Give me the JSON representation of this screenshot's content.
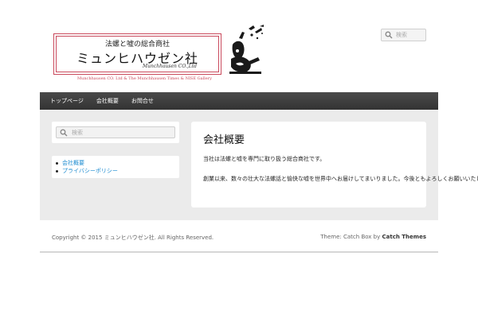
{
  "header": {
    "logo_tagline": "法螺と嘘の総合商社",
    "logo_name": "ミュンヒハウゼン社",
    "logo_script": "Munchhausen CO.,Ltd",
    "logo_subtitle": "Munchhausen CO. Ltd & The Munchhausen Times & NISE Gallery",
    "search_placeholder": "検索"
  },
  "nav": {
    "items": [
      "トップページ",
      "会社概要",
      "お問合せ"
    ]
  },
  "sidebar": {
    "search_placeholder": "検索",
    "links": [
      "会社概要",
      "プライバシーポリシー"
    ]
  },
  "content": {
    "title": "会社概要",
    "paragraph1": "当社は法螺と嘘を専門に取り扱う総合商社です。",
    "paragraph2": "創業以来、数々の壮大な法螺話と愉快な嘘を世界中へお届けしてまいりました。今後ともよろしくお願いいたします。"
  },
  "footer": {
    "copyright": "Copyright © 2015 ミュンヒハウゼン社. All Rights Reserved.",
    "theme_prefix": "Theme: Catch Box by ",
    "theme_author": "Catch Themes"
  },
  "colors": {
    "logo_accent": "#c9485b",
    "link": "#1b8bd0",
    "nav_bg": "#3d3d3d",
    "content_bg": "#ebebeb"
  }
}
